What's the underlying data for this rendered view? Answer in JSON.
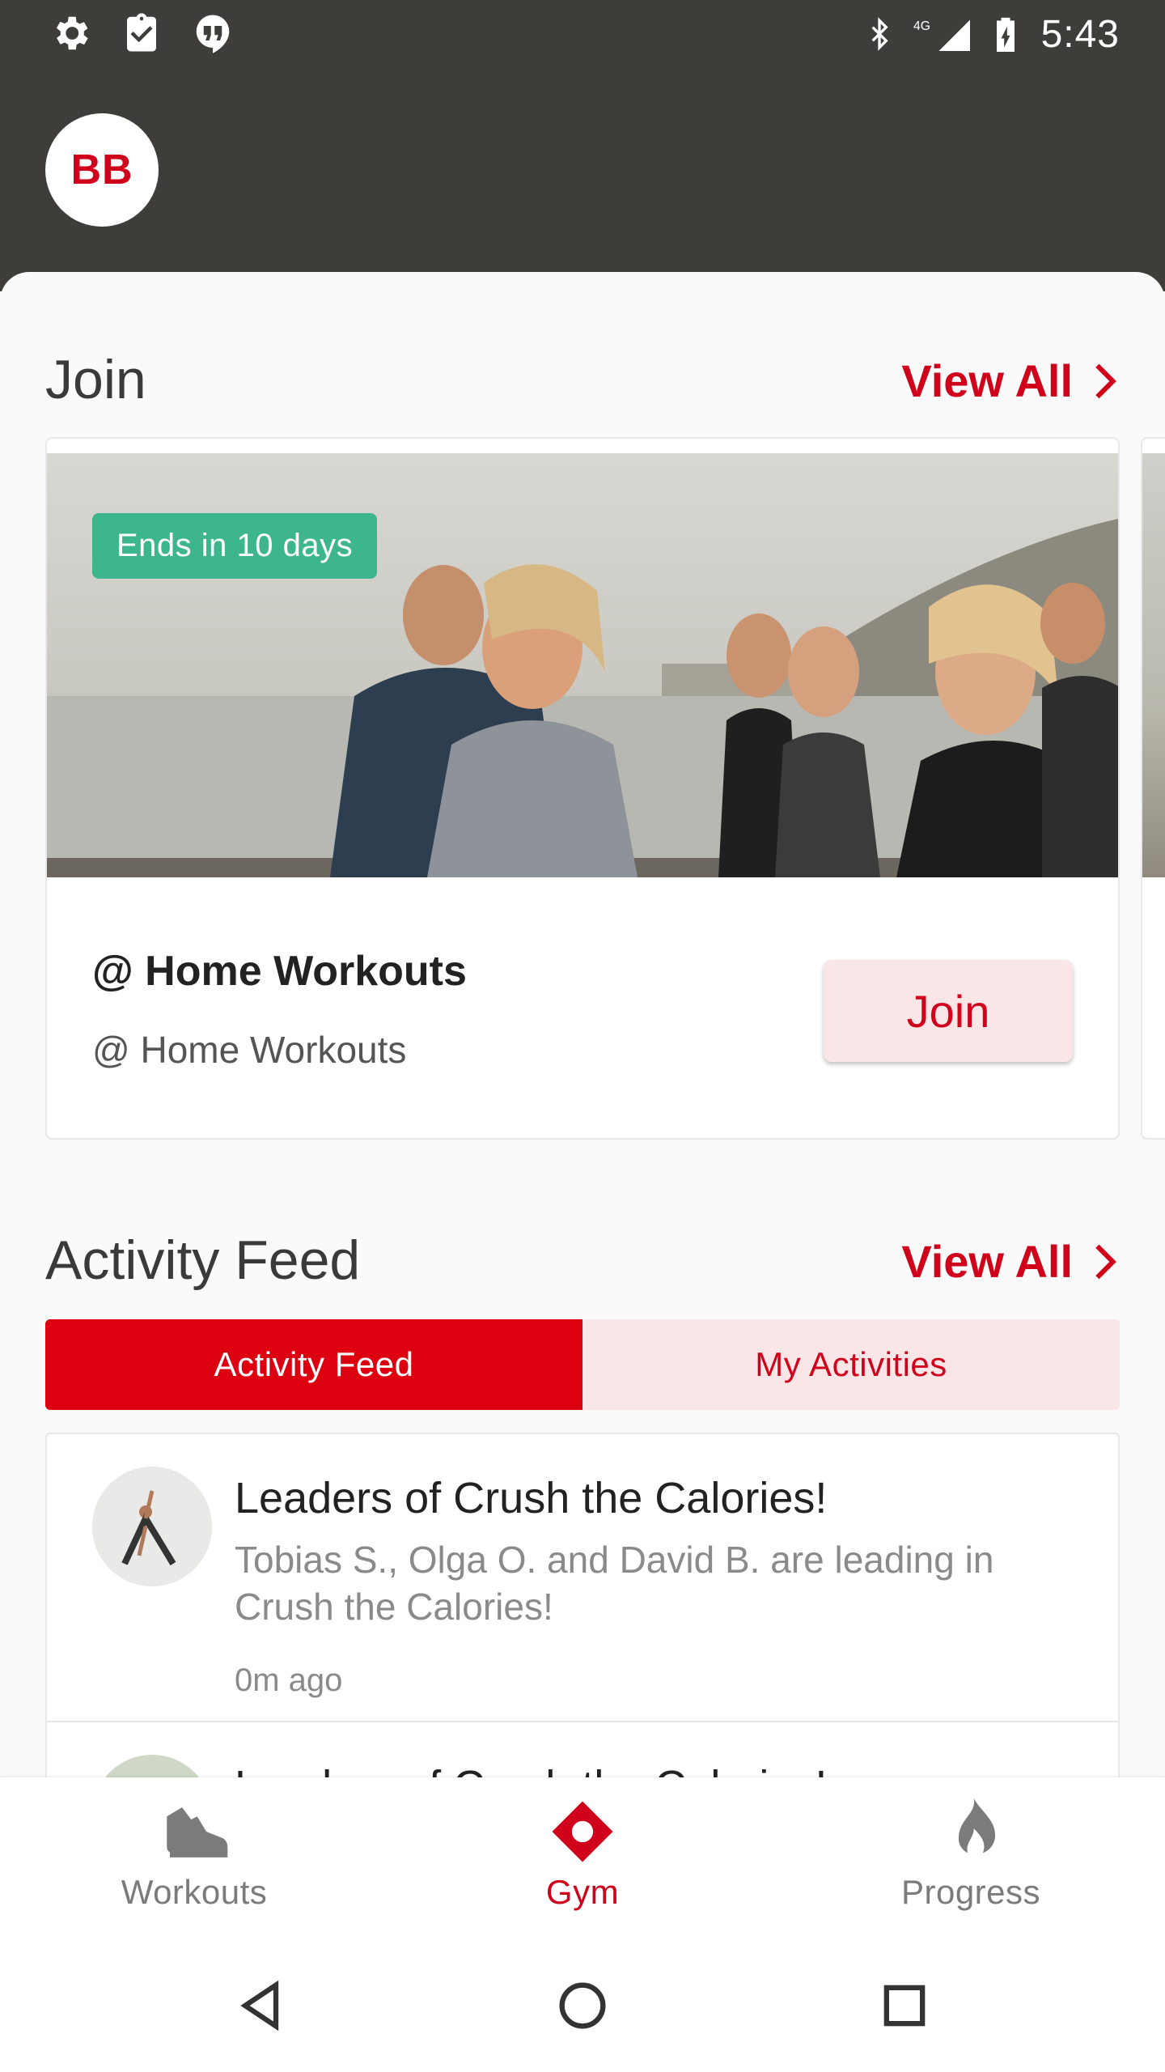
{
  "status_bar": {
    "time": "5:43",
    "network": "4G",
    "left_icons": [
      "settings-icon",
      "clipboard-check-icon",
      "quote-bubble-icon"
    ],
    "right_icons": [
      "bluetooth-icon",
      "signal-icon",
      "battery-charging-icon"
    ]
  },
  "header": {
    "avatar_initials": "BB"
  },
  "join_section": {
    "title": "Join",
    "view_all": "View All",
    "card": {
      "badge": "Ends in 10 days",
      "title": "@ Home Workouts",
      "subtitle": "@ Home Workouts",
      "join_label": "Join"
    }
  },
  "activity_section": {
    "title": "Activity Feed",
    "view_all": "View All",
    "tabs": [
      {
        "label": "Activity Feed",
        "active": true
      },
      {
        "label": "My Activities",
        "active": false
      }
    ],
    "items": [
      {
        "title": "Leaders of Crush the Calories!",
        "body": "Tobias S., Olga O. and David B. are leading in Crush the Calories!",
        "time": "0m ago"
      },
      {
        "title": "Leaders of Crush the Calories!",
        "body": "",
        "time": ""
      }
    ]
  },
  "bottom_nav": {
    "items": [
      {
        "label": "Workouts",
        "icon": "shoe-icon",
        "active": false
      },
      {
        "label": "Gym",
        "icon": "gym-location-icon",
        "active": true
      },
      {
        "label": "Progress",
        "icon": "flame-icon",
        "active": false
      }
    ]
  },
  "system_nav": [
    "back-icon",
    "home-icon",
    "recents-icon"
  ],
  "colors": {
    "accent": "#d0021b",
    "header_bg": "#3e3d39",
    "badge_green": "#3db68e",
    "tab_inactive_bg": "#fbe6e7"
  }
}
